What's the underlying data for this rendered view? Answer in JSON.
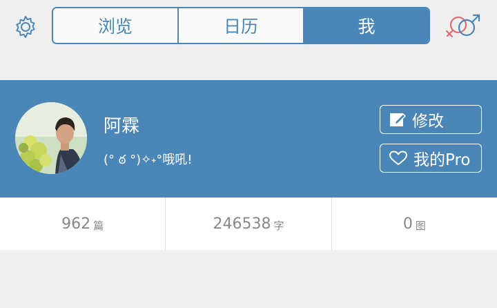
{
  "tabs": [
    {
      "label": "浏览",
      "active": false
    },
    {
      "label": "日历",
      "active": false
    },
    {
      "label": "我",
      "active": true
    }
  ],
  "icons": {
    "settings": "gear-icon",
    "gender": "gender-icon",
    "edit": "edit-icon",
    "pro": "heart-icon"
  },
  "colors": {
    "accent": "#4a86b8",
    "background": "#efefef",
    "stat_text": "#888888",
    "gender_male": "#4a86b8",
    "gender_female": "#e56a6a"
  },
  "profile": {
    "username": "阿霖",
    "motto": "(° ఠ °)✧˖°哦吼!",
    "edit_label": "修改",
    "pro_label": "我的Pro"
  },
  "stats": [
    {
      "value": "962",
      "unit": "篇"
    },
    {
      "value": "246538",
      "unit": "字"
    },
    {
      "value": "0",
      "unit": "图"
    }
  ]
}
